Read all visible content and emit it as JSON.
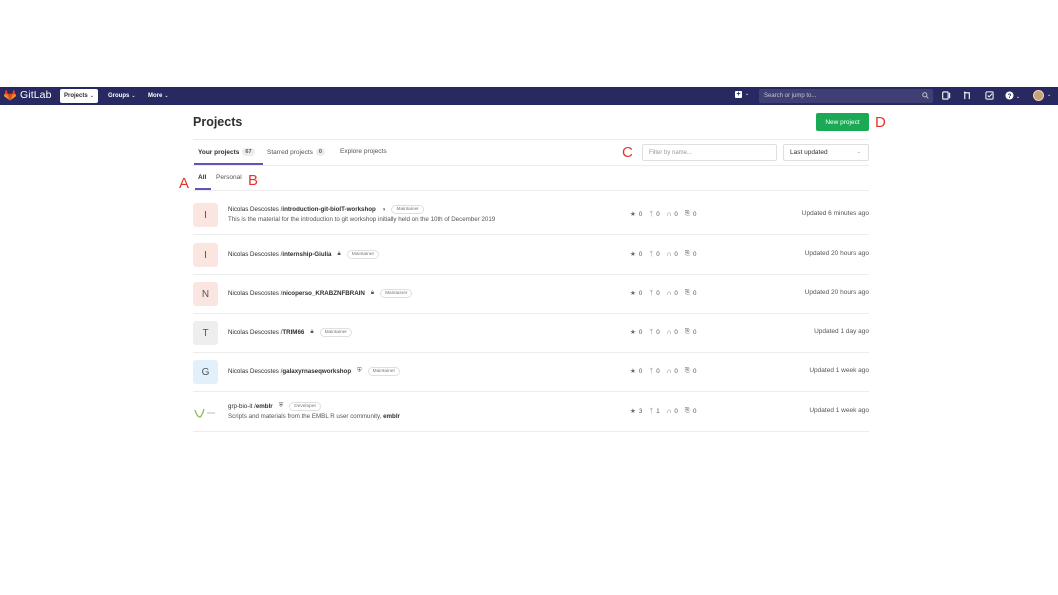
{
  "navbar": {
    "brand": "GitLab",
    "projects": "Projects",
    "groups": "Groups",
    "more": "More",
    "search_placeholder": "Search or jump to...",
    "bg_color": "#292961"
  },
  "page": {
    "title": "Projects",
    "new_project": "New project"
  },
  "tabs": {
    "your_projects": "Your projects",
    "your_count": "67",
    "starred": "Starred projects",
    "starred_count": "0",
    "explore": "Explore projects"
  },
  "filter_placeholder": "Filter by name...",
  "sort_label": "Last updated",
  "subtabs": {
    "all": "All",
    "personal": "Personal"
  },
  "markers": {
    "a": "A",
    "b": "B",
    "c": "C",
    "d": "D"
  },
  "projects": [
    {
      "avatar": "I",
      "avatar_bg": "#fbe5e1",
      "namespace": "Nicolas Descostes / ",
      "name": "introduction-git-bioIT-workshop",
      "visibility_icon": "globe-icon",
      "role": "Maintainer",
      "description": "This is the material for the introduction to git workshop initially held on the 10th of December 2019",
      "stars": "0",
      "forks": "0",
      "merge_requests": "0",
      "issues": "0",
      "updated": "Updated 6 minutes ago"
    },
    {
      "avatar": "I",
      "avatar_bg": "#fbe5e1",
      "namespace": "Nicolas Descostes / ",
      "name": "internship-Giulia",
      "visibility_icon": "lock-icon",
      "role": "Maintainer",
      "stars": "0",
      "forks": "0",
      "merge_requests": "0",
      "issues": "0",
      "updated": "Updated 20 hours ago"
    },
    {
      "avatar": "N",
      "avatar_bg": "#fbe5e1",
      "namespace": "Nicolas Descostes / ",
      "name": "nicoperso_KRABZNFBRAIN",
      "visibility_icon": "lock-icon",
      "role": "Maintainer",
      "stars": "0",
      "forks": "0",
      "merge_requests": "0",
      "issues": "0",
      "updated": "Updated 20 hours ago"
    },
    {
      "avatar": "T",
      "avatar_bg": "#eeeeee",
      "namespace": "Nicolas Descostes / ",
      "name": "TRIM66",
      "visibility_icon": "lock-icon",
      "role": "Maintainer",
      "stars": "0",
      "forks": "0",
      "merge_requests": "0",
      "issues": "0",
      "updated": "Updated 1 day ago"
    },
    {
      "avatar": "G",
      "avatar_bg": "#e1f0fb",
      "namespace": "Nicolas Descostes / ",
      "name": "galaxyrnaseqworkshop",
      "visibility_icon": "shield-icon",
      "role": "Maintainer",
      "stars": "0",
      "forks": "0",
      "merge_requests": "0",
      "issues": "0",
      "updated": "Updated 1 week ago"
    },
    {
      "avatar": "",
      "avatar_bg": "#ffffff",
      "namespace": "grp-bio-it / ",
      "name": "emblr",
      "visibility_icon": "shield-icon",
      "role": "Developer",
      "description": "Scripts and materials from the EMBL R user community, ",
      "description_bold": "emblr",
      "stars": "3",
      "forks": "1",
      "merge_requests": "0",
      "issues": "0",
      "updated": "Updated 1 week ago"
    }
  ]
}
